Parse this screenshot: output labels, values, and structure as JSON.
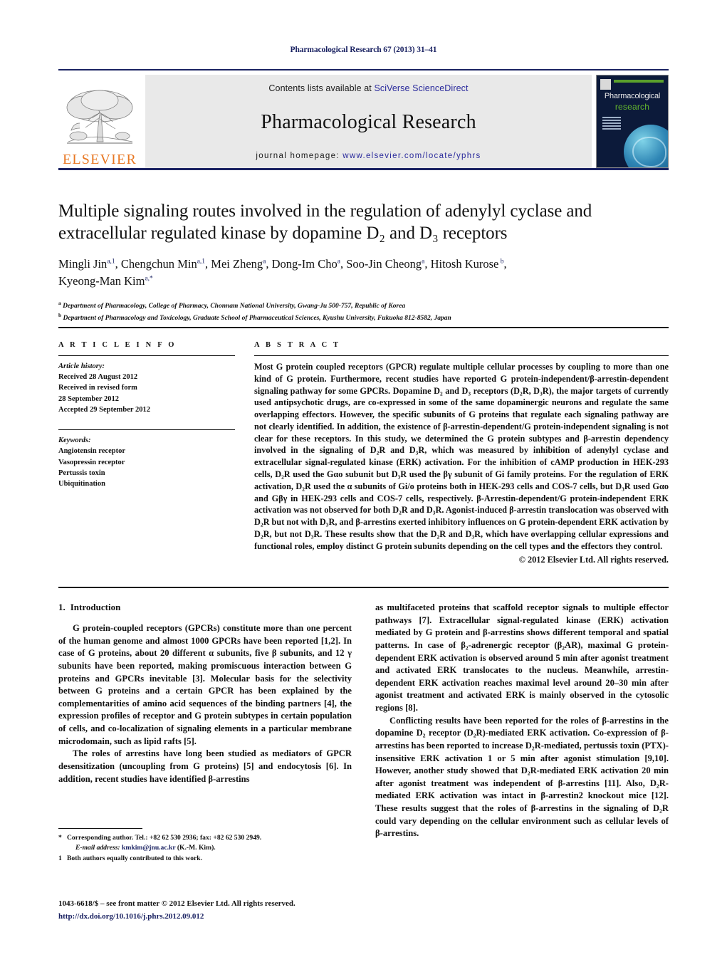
{
  "running_head": "Pharmacological Research 67 (2013) 31–41",
  "masthead": {
    "publisher_logo_label": "ELSEVIER",
    "contents_prefix": "Contents lists available at ",
    "contents_link": "SciVerse ScienceDirect",
    "journal_name": "Pharmacological Research",
    "homepage_prefix": "journal homepage: ",
    "homepage_link": "www.elsevier.com/locate/yphrs",
    "cover": {
      "title_line1": "Pharmacological",
      "title_line2": "research"
    }
  },
  "article": {
    "title": "Multiple signaling routes involved in the regulation of adenylyl cyclase and extracellular regulated kinase by dopamine D₂ and D₃ receptors",
    "authors": "Mingli Jin a,1, Chengchun Min a,1, Mei Zheng a, Dong-Im Cho a, Soo-Jin Cheong a, Hitosh Kurose b, Kyeong-Man Kim a,*",
    "affiliation_a": "Department of Pharmacology, College of Pharmacy, Chonnam National University, Gwang-Ju 500-757, Republic of Korea",
    "affiliation_b": "Department of Pharmacology and Toxicology, Graduate School of Pharmaceutical Sciences, Kyushu University, Fukuoka 812-8582, Japan"
  },
  "article_info": {
    "heading": "A R T I C L E    I N F O",
    "history_label": "Article history:",
    "history_lines": [
      "Received 28 August 2012",
      "Received in revised form",
      "28 September 2012",
      "Accepted 29 September 2012"
    ],
    "keywords_label": "Keywords:",
    "keywords": [
      "Angiotensin receptor",
      "Vasopressin receptor",
      "Pertussis toxin",
      "Ubiquitination"
    ]
  },
  "abstract": {
    "heading": "A B S T R A C T",
    "text": "Most G protein coupled receptors (GPCR) regulate multiple cellular processes by coupling to more than one kind of G protein. Furthermore, recent studies have reported G protein-independent/β-arrestin-dependent signaling pathway for some GPCRs. Dopamine D₂ and D₃ receptors (D₂R, D₃R), the major targets of currently used antipsychotic drugs, are co-expressed in some of the same dopaminergic neurons and regulate the same overlapping effectors. However, the specific subunits of G proteins that regulate each signaling pathway are not clearly identified. In addition, the existence of β-arrestin-dependent/G protein-independent signaling is not clear for these receptors. In this study, we determined the G protein subtypes and β-arrestin dependency involved in the signaling of D₂R and D₃R, which was measured by inhibition of adenylyl cyclase and extracellular signal-regulated kinase (ERK) activation. For the inhibition of cAMP production in HEK-293 cells, D₂R used the Gαo subunit but D₃R used the βγ subunit of Gi family proteins. For the regulation of ERK activation, D₂R used the α subunits of Gi/o proteins both in HEK-293 cells and COS-7 cells, but D₃R used Gαo and Gβγ in HEK-293 cells and COS-7 cells, respectively. β-Arrestin-dependent/G protein-independent ERK activation was not observed for both D₂R and D₃R. Agonist-induced β-arrestin translocation was observed with D₂R but not with D₃R, and β-arrestins exerted inhibitory influences on G protein-dependent ERK activation by D₂R, but not D₃R. These results show that the D₂R and D₃R, which have overlapping cellular expressions and functional roles, employ distinct G protein subunits depending on the cell types and the effectors they control.",
    "copyright": "© 2012 Elsevier Ltd. All rights reserved."
  },
  "introduction": {
    "number": "1.",
    "title": "Introduction",
    "left_paragraphs": [
      "G protein-coupled receptors (GPCRs) constitute more than one percent of the human genome and almost 1000 GPCRs have been reported [1,2]. In case of G proteins, about 20 different α subunits, five β subunits, and 12 γ subunits have been reported, making promiscuous interaction between G proteins and GPCRs inevitable [3]. Molecular basis for the selectivity between G proteins and a certain GPCR has been explained by the complementarities of amino acid sequences of the binding partners [4], the expression profiles of receptor and G protein subtypes in certain population of cells, and co-localization of signaling elements in a particular membrane microdomain, such as lipid rafts [5].",
      "The roles of arrestins have long been studied as mediators of GPCR desensitization (uncoupling from G proteins) [5] and endocytosis [6]. In addition, recent studies have identified β-arrestins"
    ],
    "right_paragraphs": [
      "as multifaceted proteins that scaffold receptor signals to multiple effector pathways [7]. Extracellular signal-regulated kinase (ERK) activation mediated by G protein and β-arrestins shows different temporal and spatial patterns. In case of β₂-adrenergic receptor (β₂AR), maximal G protein-dependent ERK activation is observed around 5 min after agonist treatment and activated ERK translocates to the nucleus. Meanwhile, arrestin-dependent ERK activation reaches maximal level around 20–30 min after agonist treatment and activated ERK is mainly observed in the cytosolic regions [8].",
      "Conflicting results have been reported for the roles of β-arrestins in the dopamine D₂ receptor (D₂R)-mediated ERK activation. Co-expression of β-arrestins has been reported to increase D₂R-mediated, pertussis toxin (PTX)-insensitive ERK activation 1 or 5 min after agonist stimulation [9,10]. However, another study showed that D₂R-mediated ERK activation 20 min after agonist treatment was independent of β-arrestins [11]. Also, D₂R-mediated ERK activation was intact in β-arrestin2 knockout mice [12]. These results suggest that the roles of β-arrestins in the signaling of D₂R could vary depending on the cellular environment such as cellular levels of β-arrestins."
    ]
  },
  "footnotes": {
    "corresponding": "Corresponding author. Tel.: +82 62 530 2936; fax: +82 62 530 2949.",
    "email_label": "E-mail address:",
    "email": "kmkim@jnu.ac.kr",
    "email_suffix": "(K.-M. Kim).",
    "equal_contribution": "Both authors equally contributed to this work.",
    "mark_corresponding": "*",
    "mark_equal": "1"
  },
  "footer": {
    "issn_line": "1043-6618/$ – see front matter © 2012 Elsevier Ltd. All rights reserved.",
    "doi": "http://dx.doi.org/10.1016/j.phrs.2012.09.012"
  }
}
